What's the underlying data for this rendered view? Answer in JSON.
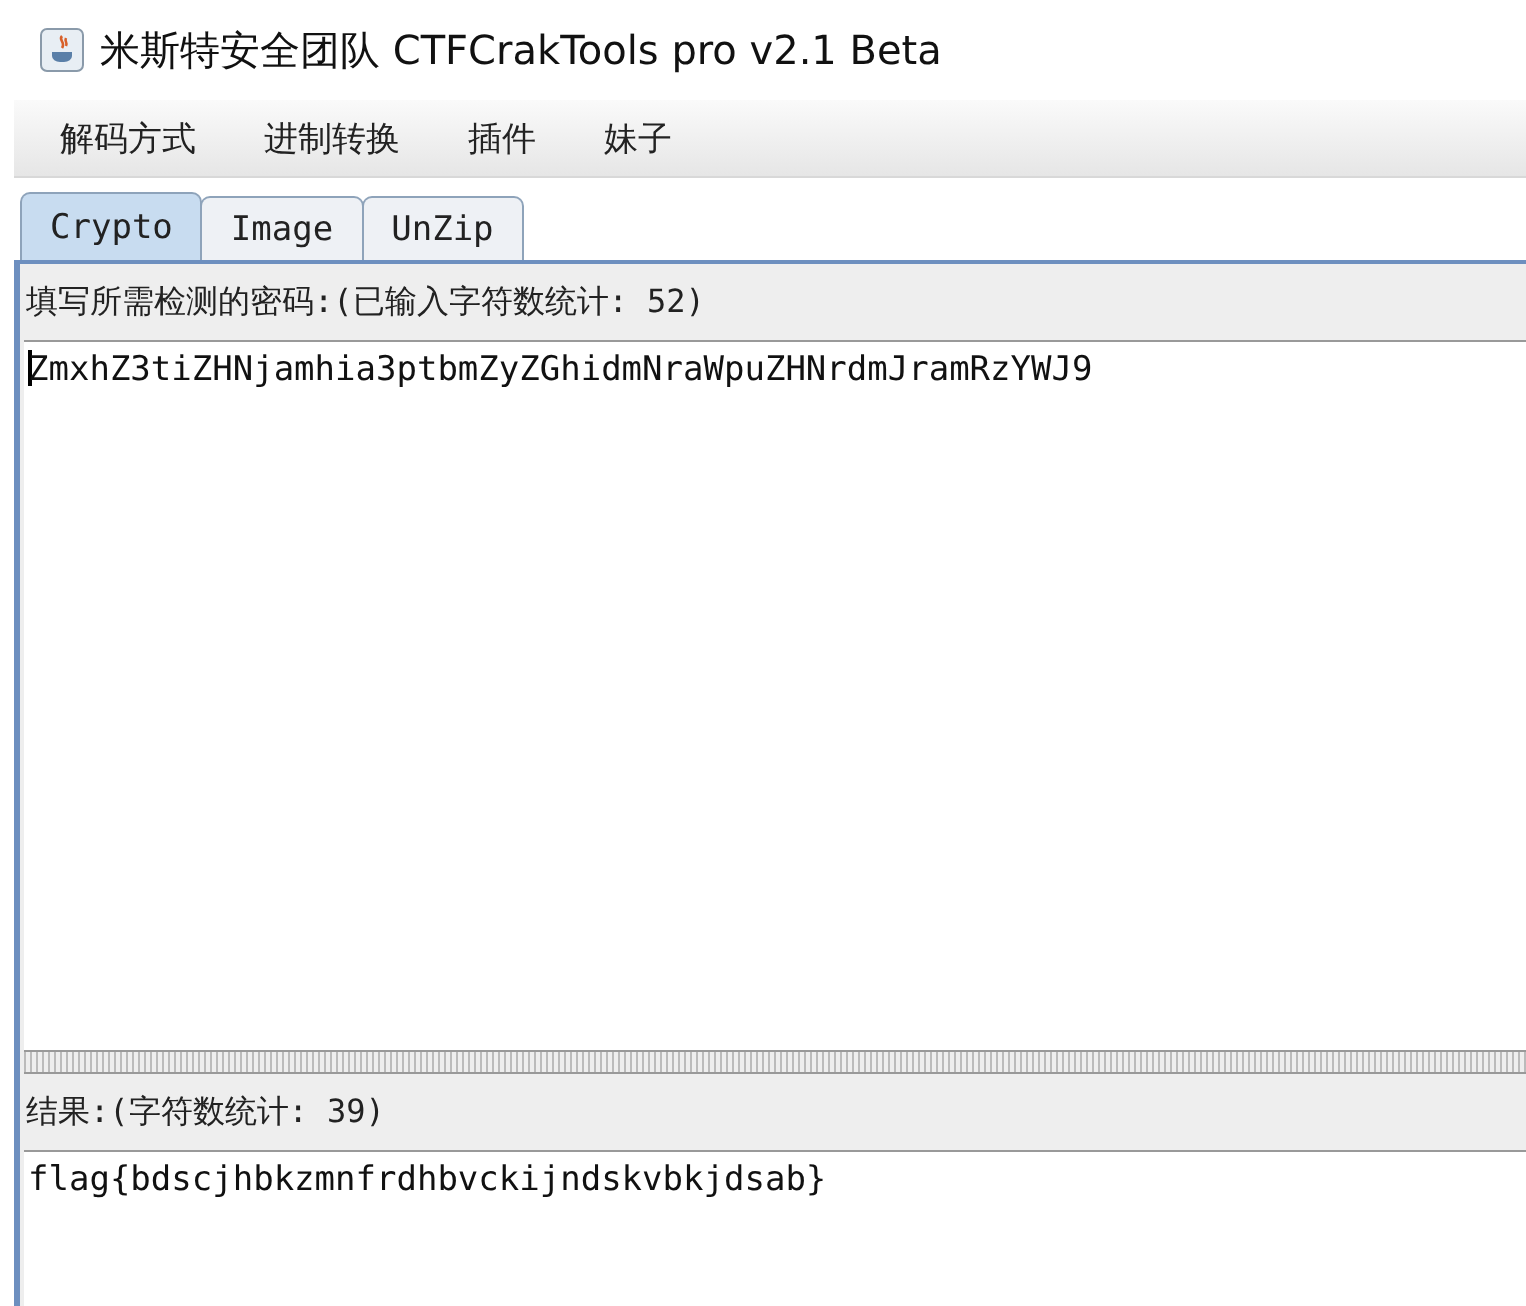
{
  "window": {
    "title": "米斯特安全团队 CTFCrakTools pro v2.1 Beta"
  },
  "menu": [
    "解码方式",
    "进制转换",
    "插件",
    "妹子"
  ],
  "tabs": [
    {
      "label": "Crypto",
      "selected": true
    },
    {
      "label": "Image",
      "selected": false
    },
    {
      "label": "UnZip",
      "selected": false
    }
  ],
  "input": {
    "label": "填写所需检测的密码:(已输入字符数统计: 52)",
    "value": "ZmxhZ3tiZHNjamhia3ptbmZyZGhidmNraWpuZHNrdmJramRzYWJ9"
  },
  "result": {
    "label": "结果:(字符数统计: 39)",
    "value": "flag{bdscjhbkzmnfrdhbvckijndskvbkjdsab}"
  }
}
